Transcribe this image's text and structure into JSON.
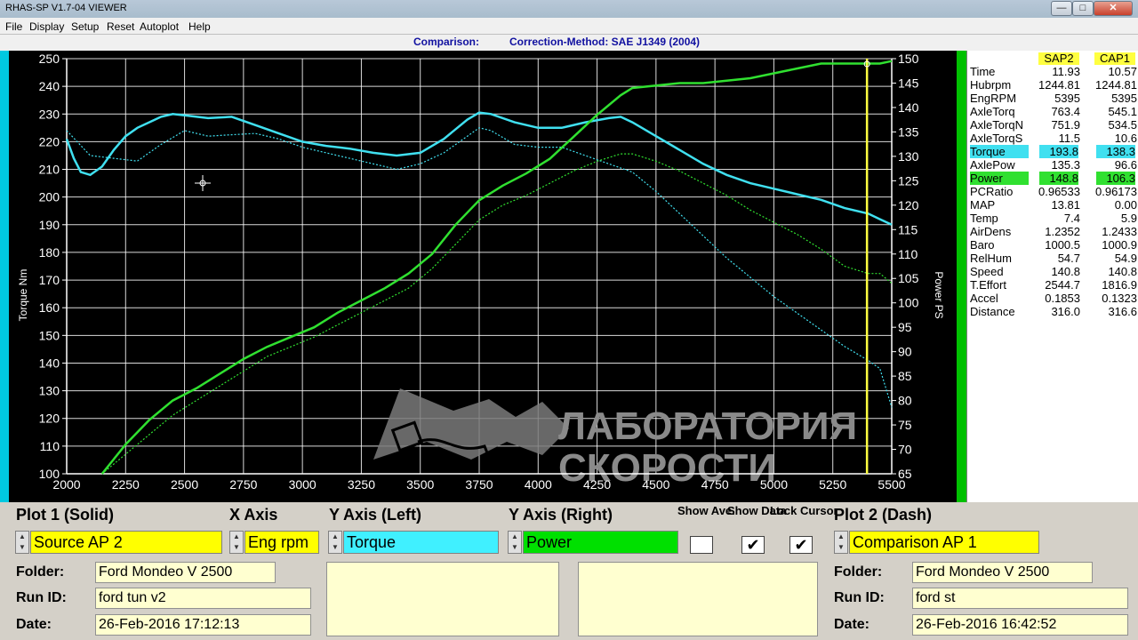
{
  "window": {
    "title": "RHAS-SP V1.7-04  VIEWER",
    "controls": {
      "minimize": "—",
      "maximize": "□",
      "close": "✕"
    }
  },
  "menu": [
    "File",
    "Display",
    "Setup",
    "Reset",
    "Autoplot",
    "Help"
  ],
  "header": {
    "comparison": "Comparison:",
    "correction": "Correction-Method: SAE J1349 (2004)"
  },
  "watermark": {
    "line1": "ЛАБОРАТОРИЯ",
    "line2": "СКОРОСТИ"
  },
  "chart_data": {
    "type": "line",
    "xlabel": "",
    "ylabel_left": "Torque Nm",
    "ylabel_right": "Power PS",
    "xlim": [
      2000,
      5500
    ],
    "ylim_left": [
      100,
      250
    ],
    "ylim_right": [
      65,
      150
    ],
    "x_ticks": [
      2000,
      2250,
      2500,
      2750,
      3000,
      3250,
      3500,
      3750,
      4000,
      4250,
      4500,
      4750,
      5000,
      5250,
      5500
    ],
    "y_left_ticks": [
      100,
      110,
      120,
      130,
      140,
      150,
      160,
      170,
      180,
      190,
      200,
      210,
      220,
      230,
      240,
      250
    ],
    "y_right_ticks": [
      65,
      70,
      75,
      80,
      85,
      90,
      95,
      100,
      105,
      110,
      115,
      120,
      125,
      130,
      135,
      140,
      145,
      150
    ],
    "grid": true,
    "cursor_x": 5395,
    "colors": {
      "torque": "#40e0f0",
      "power": "#30e030",
      "cursor": "#ffff40"
    },
    "series": [
      {
        "axis": "left",
        "style": "solid",
        "color": "#40e0f0",
        "x": [
          2000,
          2030,
          2060,
          2100,
          2150,
          2200,
          2250,
          2300,
          2350,
          2400,
          2450,
          2500,
          2600,
          2700,
          2800,
          2900,
          3000,
          3100,
          3200,
          3300,
          3400,
          3500,
          3600,
          3700,
          3750,
          3800,
          3900,
          4000,
          4100,
          4200,
          4300,
          4350,
          4400,
          4500,
          4600,
          4700,
          4800,
          4900,
          5000,
          5100,
          5200,
          5300,
          5400,
          5450,
          5500
        ],
        "values": [
          221,
          214,
          209,
          208,
          211,
          217,
          222,
          225,
          227,
          229,
          230,
          229.5,
          228.5,
          229,
          226,
          223,
          220,
          218.5,
          217.5,
          216,
          215,
          216,
          221,
          228,
          230.5,
          230,
          227,
          225,
          225,
          227,
          228.5,
          229,
          227,
          222,
          217,
          212,
          208,
          205,
          203,
          201,
          199,
          196,
          194,
          192,
          190
        ]
      },
      {
        "axis": "left",
        "style": "dashed",
        "color": "#40e0f0",
        "x": [
          2000,
          2100,
          2200,
          2300,
          2400,
          2500,
          2600,
          2700,
          2800,
          2900,
          3000,
          3100,
          3200,
          3300,
          3400,
          3500,
          3600,
          3700,
          3750,
          3800,
          3900,
          4000,
          4100,
          4200,
          4300,
          4400,
          4500,
          4600,
          4700,
          4800,
          4900,
          5000,
          5100,
          5200,
          5300,
          5400,
          5450,
          5500
        ],
        "values": [
          224,
          215,
          214,
          213,
          219,
          224,
          222,
          222.5,
          223,
          221,
          218,
          216,
          214,
          212,
          210,
          212,
          216,
          222,
          225,
          224,
          219,
          218,
          218,
          215,
          212,
          209,
          202,
          194,
          186,
          178,
          171,
          164,
          158,
          152,
          146,
          141,
          138,
          124
        ]
      },
      {
        "axis": "right",
        "style": "solid",
        "color": "#30e030",
        "x": [
          2150,
          2250,
          2350,
          2450,
          2550,
          2650,
          2750,
          2850,
          2950,
          3050,
          3150,
          3250,
          3350,
          3450,
          3550,
          3650,
          3750,
          3850,
          3950,
          4050,
          4150,
          4250,
          4350,
          4400,
          4500,
          4600,
          4700,
          4800,
          4900,
          5000,
          5100,
          5200,
          5300,
          5400,
          5450,
          5500
        ],
        "values": [
          65,
          71,
          76,
          80,
          82.5,
          85.5,
          88.5,
          91,
          93,
          95,
          98,
          100.5,
          103,
          106,
          110,
          116,
          121,
          124,
          126.5,
          129.5,
          134,
          138.5,
          142.5,
          144,
          144.5,
          145,
          145,
          145.5,
          146,
          147,
          148,
          149,
          149,
          149,
          149,
          149.5
        ]
      },
      {
        "axis": "right",
        "style": "dashed",
        "color": "#30e030",
        "x": [
          2150,
          2250,
          2350,
          2450,
          2550,
          2650,
          2750,
          2850,
          2950,
          3050,
          3150,
          3250,
          3350,
          3450,
          3550,
          3650,
          3750,
          3850,
          3950,
          4050,
          4150,
          4250,
          4350,
          4400,
          4500,
          4600,
          4700,
          4800,
          4900,
          5000,
          5100,
          5200,
          5300,
          5400,
          5450,
          5500
        ],
        "values": [
          65,
          69,
          73,
          77,
          80,
          83,
          86,
          89,
          91,
          93,
          95.5,
          98,
          100.5,
          103,
          107,
          112,
          117,
          120,
          122,
          124.5,
          127,
          129,
          130.5,
          130.5,
          129,
          127,
          124.5,
          122,
          119,
          116.5,
          114,
          111,
          107.5,
          106,
          106,
          104
        ]
      }
    ]
  },
  "table": {
    "headers": [
      "SAP2",
      "CAP1"
    ],
    "rows": [
      {
        "label": "Time",
        "v1": "11.93",
        "v2": "10.57"
      },
      {
        "label": "Hubrpm",
        "v1": "1244.81",
        "v2": "1244.81"
      },
      {
        "label": "EngRPM",
        "v1": "5395",
        "v2": "5395"
      },
      {
        "label": "AxleTorq",
        "v1": "763.4",
        "v2": "545.1"
      },
      {
        "label": "AxleTorqN",
        "v1": "751.9",
        "v2": "534.5"
      },
      {
        "label": "AxleTorqS",
        "v1": "11.5",
        "v2": "10.6"
      },
      {
        "label": "Torque",
        "v1": "193.8",
        "v2": "138.3",
        "highlight": "#40e0f0"
      },
      {
        "label": "AxlePow",
        "v1": "135.3",
        "v2": "96.6"
      },
      {
        "label": "Power",
        "v1": "148.8",
        "v2": "106.3",
        "highlight": "#30e030"
      },
      {
        "label": "PCRatio",
        "v1": "0.96533",
        "v2": "0.96173"
      },
      {
        "label": "MAP",
        "v1": "13.81",
        "v2": "0.00"
      },
      {
        "label": "Temp",
        "v1": "7.4",
        "v2": "5.9"
      },
      {
        "label": "AirDens",
        "v1": "1.2352",
        "v2": "1.2433"
      },
      {
        "label": "Baro",
        "v1": "1000.5",
        "v2": "1000.9"
      },
      {
        "label": "RelHum",
        "v1": "54.7",
        "v2": "54.9"
      },
      {
        "label": "Speed",
        "v1": "140.8",
        "v2": "140.8"
      },
      {
        "label": "T.Effort",
        "v1": "2544.7",
        "v2": "1816.9"
      },
      {
        "label": "Accel",
        "v1": "0.1853",
        "v2": "0.1323"
      },
      {
        "label": "Distance",
        "v1": "316.0",
        "v2": "316.6"
      }
    ]
  },
  "controls": {
    "plot1_label": "Plot 1 (Solid)",
    "xaxis_label": "X Axis",
    "yleft_label": "Y Axis (Left)",
    "yright_label": "Y Axis (Right)",
    "show_ave_label": "Show Ave.",
    "show_data_label": "Show Data",
    "lock_cursor_label": "Lock Cursor",
    "plot2_label": "Plot 2 (Dash)",
    "plot1_value": "Source AP 2",
    "xaxis_value": "Eng rpm",
    "yleft_value": "Torque",
    "yright_value": "Power",
    "plot2_value": "Comparison AP 1",
    "show_ave_checked": false,
    "show_data_checked": true,
    "lock_cursor_checked": true,
    "check_mark": "✔",
    "spin_up": "▲",
    "spin_down": "▼"
  },
  "run1": {
    "folder_label": "Folder:",
    "folder": "Ford Mondeo V 2500",
    "runid_label": "Run ID:",
    "runid": "ford tun v2",
    "date_label": "Date:",
    "date": "26-Feb-2016   17:12:13"
  },
  "run2": {
    "folder_label": "Folder:",
    "folder": "Ford Mondeo V 2500",
    "runid_label": "Run ID:",
    "runid": "ford st",
    "date_label": "Date:",
    "date": "26-Feb-2016   16:42:52"
  }
}
